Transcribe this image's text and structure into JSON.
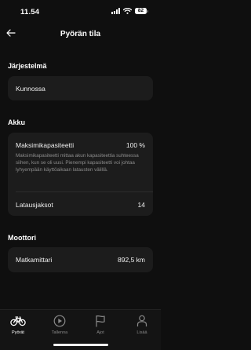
{
  "status_bar": {
    "time": "11.54",
    "battery": "82"
  },
  "header": {
    "title": "Pyörän tila"
  },
  "system": {
    "label": "Järjestelmä",
    "status": "Kunnossa"
  },
  "battery": {
    "label": "Akku",
    "max_capacity_label": "Maksimikapasiteetti",
    "max_capacity_value": "100 %",
    "max_capacity_description": "Maksimikapasiteetti mittaa akun kapasiteettia suhteessa siihen, kun se oli uusi. Pienempi kapasiteetti voi johtaa lyhyempään käyttöaikaan latausten välillä.",
    "charge_cycles_label": "Latausjaksot",
    "charge_cycles_value": "14"
  },
  "motor": {
    "label": "Moottori",
    "odometer_label": "Matkamittari",
    "odometer_value": "892,5 km"
  },
  "tabs": [
    {
      "label": "Pyörät",
      "icon": "bike-icon",
      "active": true
    },
    {
      "label": "Tallenna",
      "icon": "record-icon",
      "active": false
    },
    {
      "label": "Ajot",
      "icon": "flag-icon",
      "active": false
    },
    {
      "label": "Lisää",
      "icon": "person-icon",
      "active": false
    }
  ],
  "colors": {
    "background": "#0f0f0f",
    "card": "#1c1c1c",
    "text": "#ffffff",
    "secondary_text": "#8c8c8c"
  }
}
